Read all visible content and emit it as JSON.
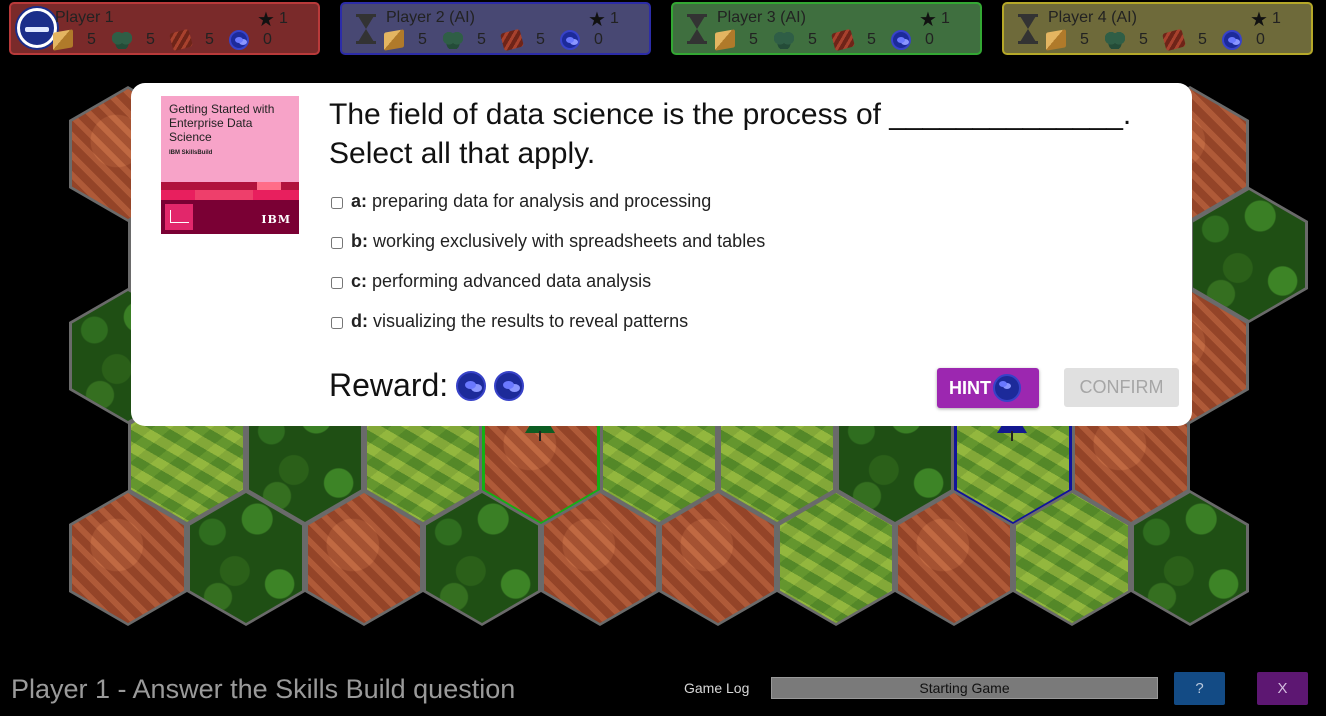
{
  "players": [
    {
      "name": "Player 1",
      "score": "1",
      "resources": [
        "5",
        "5",
        "5",
        "0"
      ],
      "active": true,
      "color": "#b93a3a",
      "bg": "#7a2a2a"
    },
    {
      "name": "Player 2 (AI)",
      "score": "1",
      "resources": [
        "5",
        "5",
        "5",
        "0"
      ],
      "active": false,
      "color": "#2c2ca8",
      "bg": "#484873"
    },
    {
      "name": "Player 3 (AI)",
      "score": "1",
      "resources": [
        "5",
        "5",
        "5",
        "0"
      ],
      "active": false,
      "color": "#33a833",
      "bg": "#3f6f3f"
    },
    {
      "name": "Player 4 (AI)",
      "score": "1",
      "resources": [
        "5",
        "5",
        "5",
        "0"
      ],
      "active": false,
      "color": "#b5a828",
      "bg": "#6e6a3a"
    }
  ],
  "resource_icons": [
    "box-icon",
    "trees-icon",
    "logs-icon",
    "coin-icon"
  ],
  "question": {
    "text": "The field of data science is the process of ______________. Select all that apply.",
    "options": [
      {
        "key": "a:",
        "text": "preparing data for analysis and processing"
      },
      {
        "key": "b:",
        "text": "working exclusively with spreadsheets and tables"
      },
      {
        "key": "c:",
        "text": "performing advanced data analysis"
      },
      {
        "key": "d:",
        "text": "visualizing the results to reveal patterns"
      }
    ],
    "reward_label": "Reward:",
    "reward_coins": 2,
    "hint_label": "HINT",
    "confirm_label": "CONFIRM"
  },
  "badge": {
    "title": "Getting Started with Enterprise Data Science",
    "brand": "IBM SkillsBuild",
    "logo": "IBM"
  },
  "footer": {
    "status": "Player 1 - Answer the Skills Build question",
    "log_label": "Game Log",
    "log_text": "Starting Game",
    "help_label": "?",
    "close_label": "X"
  }
}
